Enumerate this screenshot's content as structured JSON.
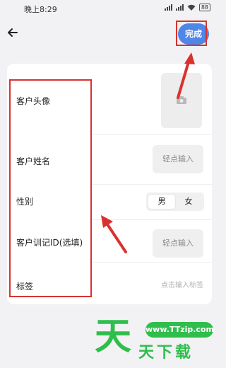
{
  "status_bar": {
    "time": "晚上8:29",
    "battery": "88"
  },
  "header": {
    "done_label": "完成"
  },
  "form": {
    "avatar_label": "客户头像",
    "name_label": "客户姓名",
    "name_placeholder": "轻点输入",
    "gender_label": "性别",
    "gender_options": [
      "男",
      "女"
    ],
    "gender_selected": "男",
    "training_id_label": "客户训记ID(选填)",
    "training_id_placeholder": "轻点输入",
    "tags_label": "标签",
    "tags_placeholder": "点击输入标签"
  },
  "watermark": {
    "logo_char": "天",
    "url": "www.TTzip.com",
    "brand": "天下载"
  },
  "colors": {
    "accent": "#4f86e8",
    "annotation": "#d9322e",
    "watermark": "#2fbe4c",
    "background": "#f2f2f4"
  },
  "icons": [
    "back-arrow-icon",
    "camera-icon",
    "signal-icon",
    "wifi-icon",
    "battery-icon"
  ]
}
